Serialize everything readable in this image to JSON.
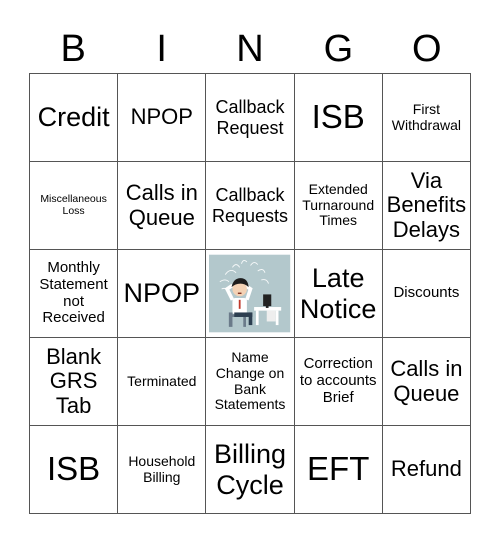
{
  "header": {
    "letters": [
      "B",
      "I",
      "N",
      "G",
      "O"
    ]
  },
  "cells": [
    [
      "Credit",
      "NPOP",
      "Callback Request",
      "ISB",
      "First Withdrawal"
    ],
    [
      "Miscellaneous Loss",
      "Calls in Queue",
      "Callback Requests",
      "Extended Turnaround Times",
      "Via Benefits Delays"
    ],
    [
      "Monthly Statement not Received",
      "NPOP",
      "",
      "Late Notice",
      "Discounts"
    ],
    [
      "Blank GRS Tab",
      "Terminated",
      "Name Change on Bank Statements",
      "Correction to accounts Brief",
      "Calls in Queue"
    ],
    [
      "ISB",
      "Household Billing",
      "Billing Cycle",
      "EFT",
      "Refund"
    ]
  ],
  "free_space": {
    "image": "stressed-office-worker-illustration",
    "background": "#b3c8cc"
  }
}
